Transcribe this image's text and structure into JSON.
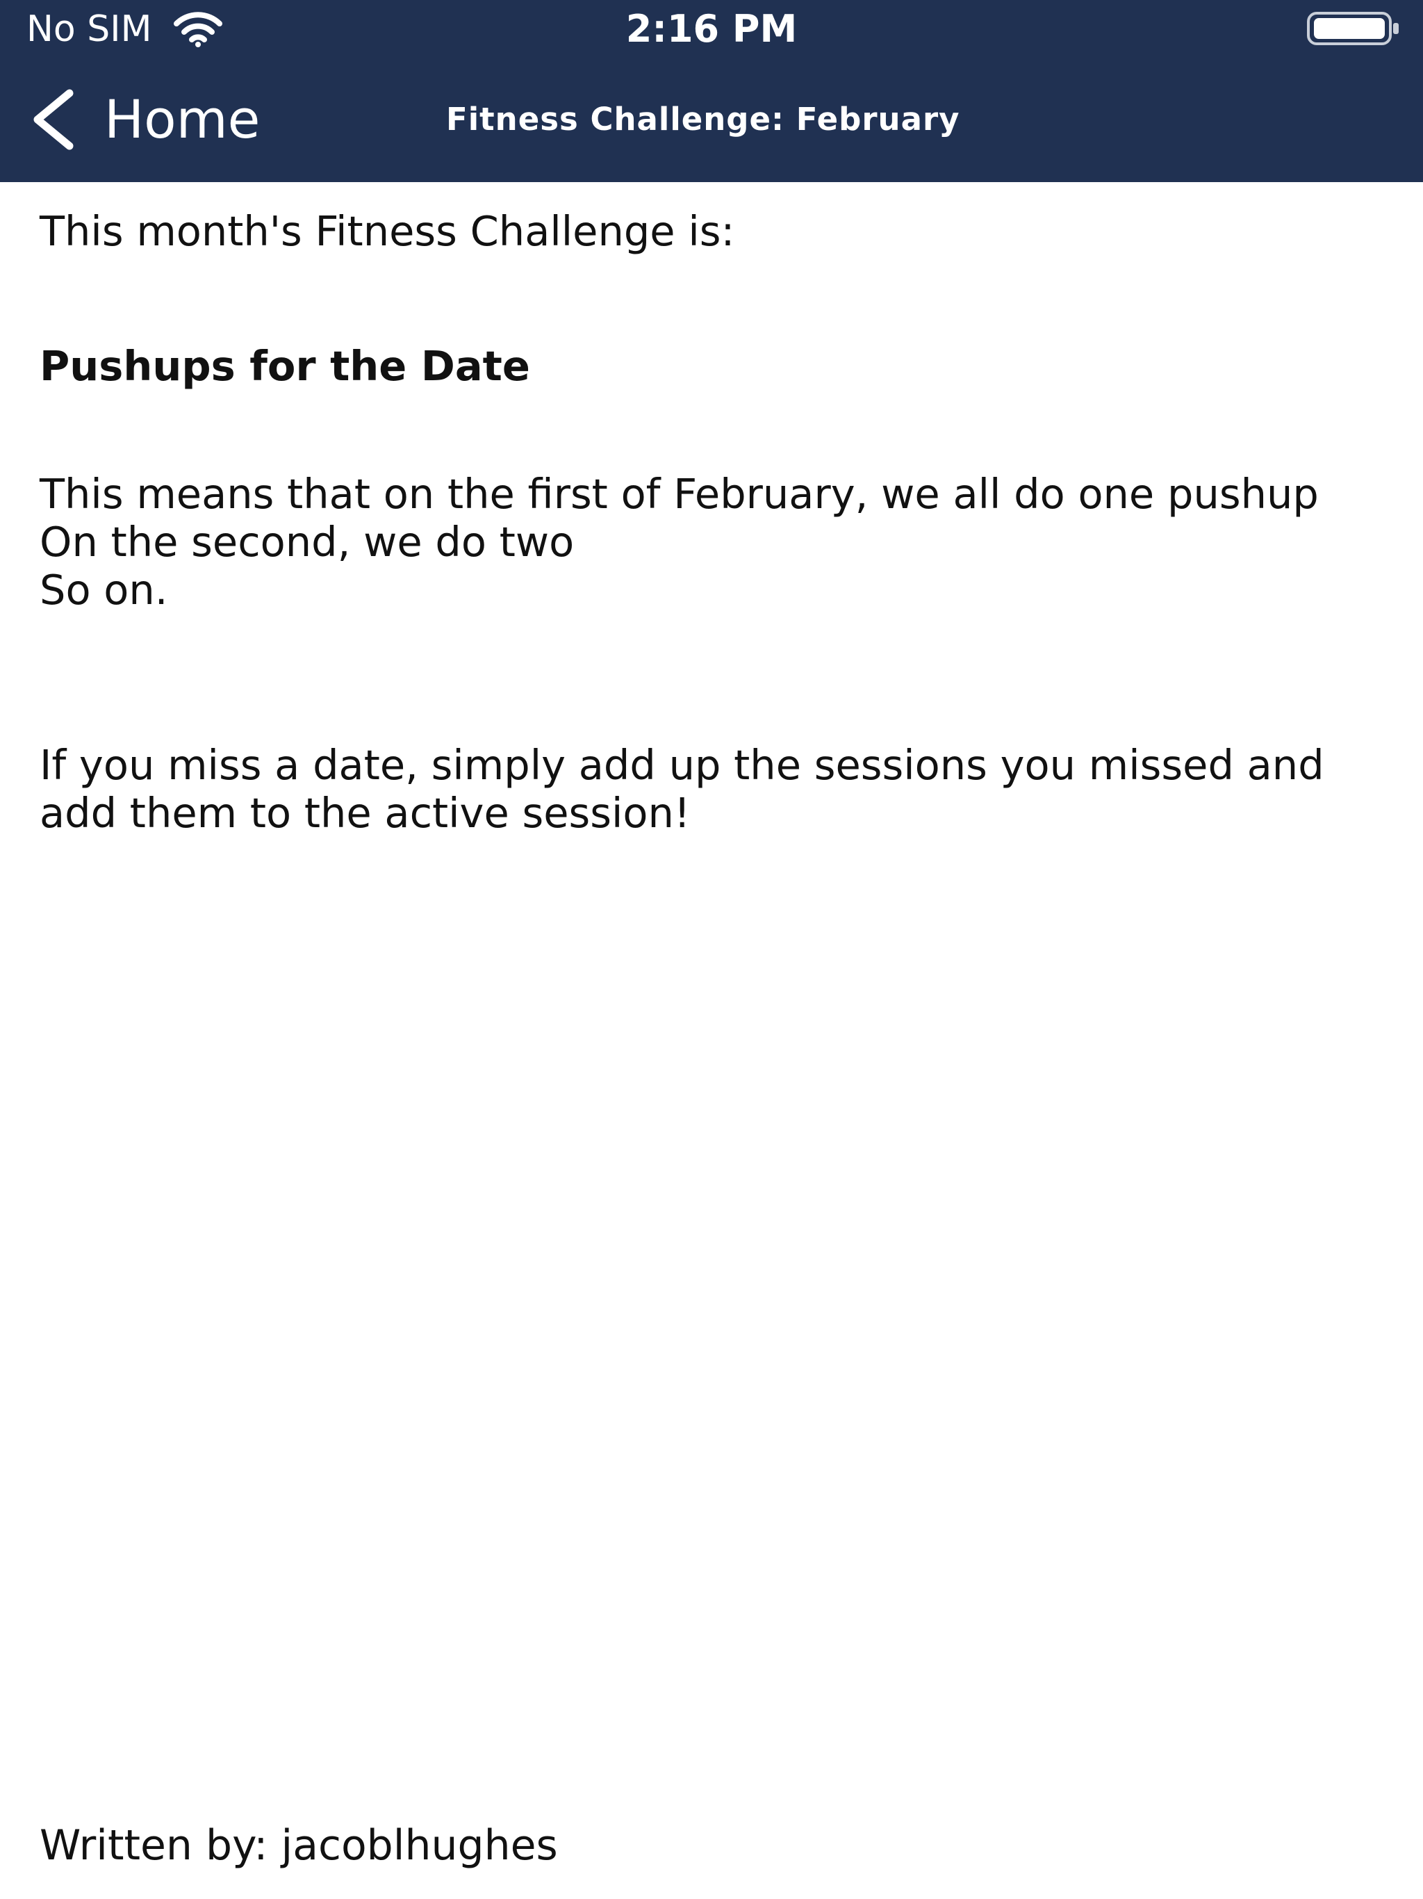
{
  "status_bar": {
    "carrier": "No SIM",
    "time": "2:16 PM",
    "icons": [
      "wifi-icon",
      "battery-icon"
    ]
  },
  "nav_bar": {
    "back_label": "Home",
    "back_icon": "chevron-left-icon",
    "title": "Fitness Challenge: February"
  },
  "article": {
    "intro": "This month's Fitness Challenge is:",
    "challenge_name": "Pushups for the Date",
    "rules": "This means that on the first of February, we all do one pushup\nOn the second, we do two\nSo on.",
    "missed_note": "If you miss a date, simply add up the sessions you missed and add them to the active session!",
    "author": "Written by: jacoblhughes"
  },
  "colors": {
    "header_background": "#203152",
    "header_text": "#ffffff",
    "body_background": "#ffffff",
    "body_text": "#111111"
  }
}
